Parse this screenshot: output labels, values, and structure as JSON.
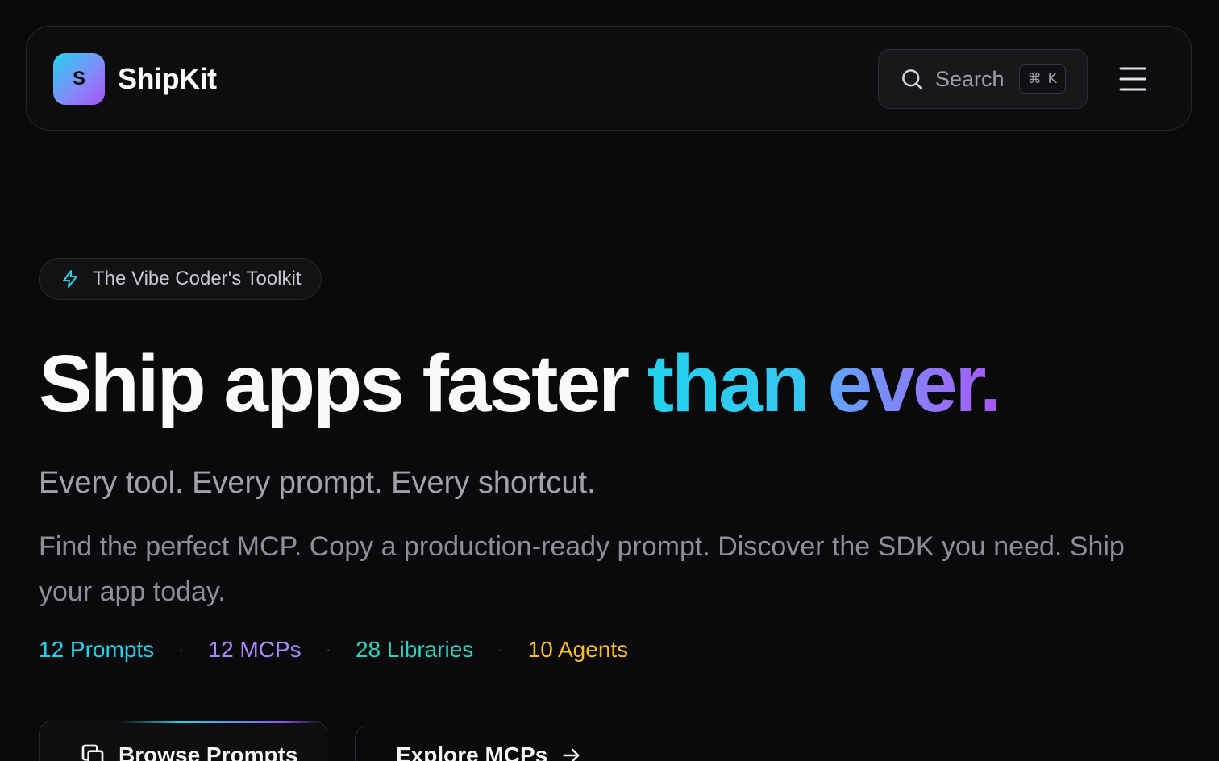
{
  "header": {
    "logo_letter": "S",
    "brand_name": "ShipKit",
    "search_label": "Search",
    "search_shortcut_symbol": "⌘",
    "search_shortcut_key": "K",
    "menu_icon": "hamburger-menu-icon"
  },
  "hero": {
    "badge_icon": "lightning-bolt-icon",
    "badge_text": "The Vibe Coder's Toolkit",
    "headline_plain": "Ship apps faster ",
    "headline_accent_1": "than",
    "headline_accent_2": "ever.",
    "subtitle": "Every tool. Every prompt. Every shortcut.",
    "description": "Find the perfect MCP. Copy a production-ready prompt. Discover the SDK you need. Ship your app today."
  },
  "stats": [
    {
      "label": "12 Prompts",
      "color": "#22d3ee"
    },
    {
      "label": "12 MCPs",
      "color": "#a78bfa"
    },
    {
      "label": "28 Libraries",
      "color": "#2dd4bf"
    },
    {
      "label": "10 Agents",
      "color": "#fbbf24"
    }
  ],
  "stat_separator": "·",
  "cta": {
    "primary_label": "Browse Prompts",
    "primary_icon": "copy-icon",
    "secondary_label": "Explore MCPs",
    "secondary_icon": "arrow-right-icon"
  },
  "colors": {
    "background": "#0a0a0c",
    "accent_cyan": "#22d3ee",
    "accent_violet": "#a855f7"
  }
}
